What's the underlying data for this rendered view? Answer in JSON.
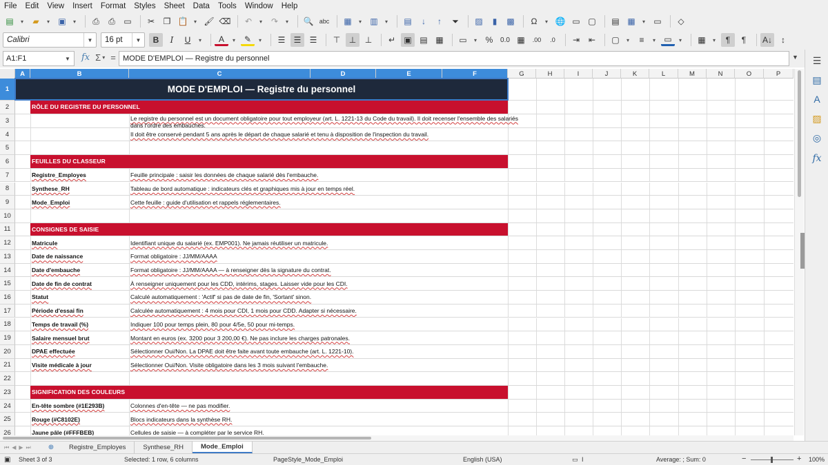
{
  "menu": [
    "File",
    "Edit",
    "View",
    "Insert",
    "Format",
    "Styles",
    "Sheet",
    "Data",
    "Tools",
    "Window",
    "Help"
  ],
  "toolbar": {
    "font_name": "Calibri",
    "font_size": "16 pt"
  },
  "formula": {
    "name_box": "A1:F1",
    "content": "MODE D'EMPLOI — Registre du personnel"
  },
  "columns": [
    "A",
    "B",
    "C",
    "D",
    "E",
    "F",
    "G",
    "H",
    "I",
    "J",
    "K",
    "L",
    "M",
    "N",
    "O",
    "P"
  ],
  "selected_columns": [
    "A",
    "B",
    "C",
    "D",
    "E",
    "F"
  ],
  "rows": [
    {
      "n": "1",
      "type": "title",
      "text": "MODE D'EMPLOI — Registre du personnel"
    },
    {
      "n": "2",
      "type": "section",
      "text": "RÔLE DU REGISTRE DU PERSONNEL"
    },
    {
      "n": "3",
      "type": "text",
      "label": "",
      "value": "Le registre du personnel est un document obligatoire pour tout employeur (art. L. 1221-13 du Code du travail). Il doit recenser l'ensemble des salariés dans l'ordre des embauches."
    },
    {
      "n": "4",
      "type": "text",
      "label": "",
      "value": "Il doit être conservé pendant 5 ans après le départ de chaque salarié et tenu à disposition de l'inspection du travail."
    },
    {
      "n": "5",
      "type": "empty"
    },
    {
      "n": "6",
      "type": "section",
      "text": "FEUILLES DU CLASSEUR"
    },
    {
      "n": "7",
      "type": "text",
      "label": "Registre_Employes",
      "value": "Feuille principale : saisir les données de chaque salarié dès l'embauche."
    },
    {
      "n": "8",
      "type": "text",
      "label": "Synthese_RH",
      "value": "Tableau de bord automatique : indicateurs clés et graphiques mis à jour en temps réel."
    },
    {
      "n": "9",
      "type": "text",
      "label": "Mode_Emploi",
      "value": "Cette feuille : guide d'utilisation et rappels réglementaires."
    },
    {
      "n": "10",
      "type": "empty"
    },
    {
      "n": "11",
      "type": "section",
      "text": "CONSIGNES DE SAISIE"
    },
    {
      "n": "12",
      "type": "text",
      "label": "Matricule",
      "value": "Identifiant unique du salarié (ex. EMP001). Ne jamais réutiliser un matricule."
    },
    {
      "n": "13",
      "type": "text",
      "label": "Date de naissance",
      "value": "Format obligatoire : JJ/MM/AAAA"
    },
    {
      "n": "14",
      "type": "text",
      "label": "Date d'embauche",
      "value": "Format obligatoire : JJ/MM/AAAA — à renseigner dès la signature du contrat."
    },
    {
      "n": "15",
      "type": "text",
      "label": "Date de fin de contrat",
      "value": "À renseigner uniquement pour les CDD, intérims, stages. Laisser vide pour les CDI."
    },
    {
      "n": "16",
      "type": "text",
      "label": "Statut",
      "value": "Calculé automatiquement : 'Actif' si pas de date de fin, 'Sortant' sinon."
    },
    {
      "n": "17",
      "type": "text",
      "label": "Période d'essai fin",
      "value": "Calculée automatiquement : 4 mois pour CDI, 1 mois pour CDD. Adapter si nécessaire."
    },
    {
      "n": "18",
      "type": "text",
      "label": "Temps de travail (%)",
      "value": "Indiquer 100 pour temps plein, 80 pour 4/5e, 50 pour mi-temps."
    },
    {
      "n": "19",
      "type": "text",
      "label": "Salaire mensuel brut",
      "value": "Montant en euros (ex. 3200 pour 3 200,00 €). Ne pas inclure les charges patronales."
    },
    {
      "n": "20",
      "type": "text",
      "label": "DPAE effectuée",
      "value": "Sélectionner Oui/Non. La DPAE doit être faite avant toute embauche (art. L. 1221-10)."
    },
    {
      "n": "21",
      "type": "text",
      "label": "Visite médicale à jour",
      "value": "Sélectionner Oui/Non. Visite obligatoire dans les 3 mois suivant l'embauche."
    },
    {
      "n": "22",
      "type": "empty"
    },
    {
      "n": "23",
      "type": "section",
      "text": "SIGNIFICATION DES COULEURS"
    },
    {
      "n": "24",
      "type": "text",
      "label": "En-tête sombre (#1E293B)",
      "value": "Colonnes d'en-tête — ne pas modifier."
    },
    {
      "n": "25",
      "type": "text",
      "label": "Rouge (#C8102E)",
      "value": "Blocs indicateurs dans la synthèse RH."
    },
    {
      "n": "26",
      "type": "text",
      "label": "Jaune pâle (#FFFBEB)",
      "value": "Cellules de saisie — à compléter par le service RH."
    }
  ],
  "tabs": [
    "Registre_Employes",
    "Synthese_RH",
    "Mode_Emploi"
  ],
  "active_tab": "Mode_Emploi",
  "status": {
    "sheet": "Sheet 3 of 3",
    "selection": "Selected: 1 row, 6 columns",
    "page_style": "PageStyle_Mode_Emploi",
    "language": "English (USA)",
    "summary": "Average: ; Sum: 0",
    "zoom": "100%"
  },
  "colors": {
    "title_bg": "#1E293B",
    "section_bg": "#C8102E",
    "selection": "#3D8CDB"
  }
}
